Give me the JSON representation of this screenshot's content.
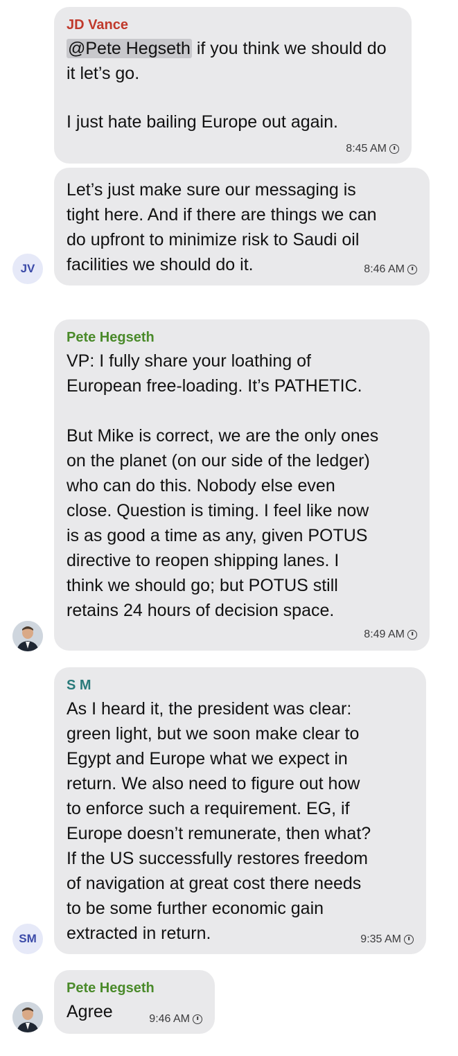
{
  "messages": [
    {
      "sender": "JD Vance",
      "mention": "@Pete Hegseth",
      "text_after_mention": " if you think we should do it let’s go.",
      "text": "I just hate bailing Europe out again.",
      "time": "8:45 AM"
    },
    {
      "text": "Let’s just make sure our messaging is\ntight here. And if there are things we can\ndo upfront to minimize risk to Saudi oil\nfacilities we should do it.",
      "time": "8:46 AM",
      "avatar": "JV"
    },
    {
      "sender": "Pete Hegseth",
      "text": "VP: I fully share your loathing of\nEuropean free-loading. It’s PATHETIC.\n\nBut Mike is correct, we are the only ones\non the planet (on our side of the ledger)\nwho can do this. Nobody else even\nclose. Question is timing. I feel like now\nis as good a time as any, given POTUS\ndirective to reopen shipping lanes. I\nthink we should go; but POTUS still\nretains 24 hours of decision space.",
      "time": "8:49 AM"
    },
    {
      "sender": "S M",
      "text": "As I heard it, the president was clear:\ngreen light, but we soon make clear to\nEgypt and Europe what we expect in\nreturn. We also need to figure out how\nto enforce such a requirement. EG, if\nEurope doesn’t remunerate, then what?\nIf the US successfully restores freedom\nof navigation at great cost there needs\nto be some further economic gain\nextracted in return.",
      "time": "9:35 AM",
      "avatar": "SM"
    },
    {
      "sender": "Pete Hegseth",
      "text": "Agree",
      "time": "9:46 AM"
    }
  ],
  "colors": {
    "bubble": "#e9e9eb",
    "jd_name": "#c0392b",
    "pete_name": "#4a8a2a",
    "sm_name": "#2a7a7a"
  }
}
